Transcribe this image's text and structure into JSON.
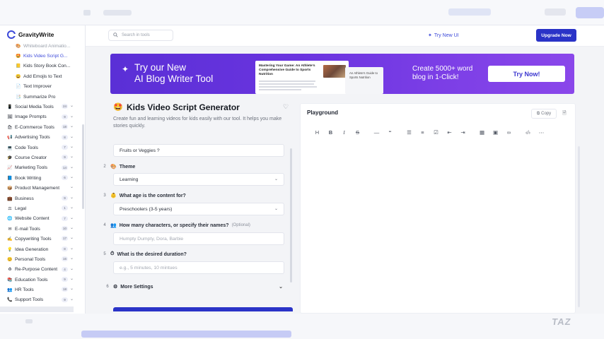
{
  "sidebar": {
    "logo": "GravityWrite",
    "items": [
      {
        "label": "Whiteboard Animatio...",
        "type": "sub",
        "icon": "🎨",
        "state": "faded"
      },
      {
        "label": "Kids Video Script G...",
        "type": "sub",
        "icon": "🤩",
        "state": "active"
      },
      {
        "label": "Kids Story Book Con...",
        "type": "sub",
        "icon": "📒"
      },
      {
        "label": "Add Emojis to Text",
        "type": "sub",
        "icon": "😀"
      },
      {
        "label": "Text Improver",
        "type": "sub",
        "icon": "📄"
      },
      {
        "label": "Summarize Pro",
        "type": "sub",
        "icon": "📑"
      },
      {
        "label": "Social Media Tools",
        "type": "cat",
        "icon": "📱",
        "count": "24"
      },
      {
        "label": "Image Prompts",
        "type": "cat",
        "icon": "🖼",
        "count": "9"
      },
      {
        "label": "E-Commerce Tools",
        "type": "cat",
        "icon": "🛍",
        "count": "18"
      },
      {
        "label": "Advertising Tools",
        "type": "cat",
        "icon": "📢",
        "count": "8"
      },
      {
        "label": "Code Tools",
        "type": "cat",
        "icon": "💻",
        "count": "7"
      },
      {
        "label": "Course Creator",
        "type": "cat",
        "icon": "🎓",
        "count": "9"
      },
      {
        "label": "Marketing Tools",
        "type": "cat",
        "icon": "📈",
        "count": "14"
      },
      {
        "label": "Book Writing",
        "type": "cat",
        "icon": "📘",
        "count": "6"
      },
      {
        "label": "Product Management",
        "type": "cat",
        "icon": "📦",
        "count": ""
      },
      {
        "label": "Business",
        "type": "cat",
        "icon": "💼",
        "count": "9"
      },
      {
        "label": "Legal",
        "type": "cat",
        "icon": "⚖",
        "count": "1"
      },
      {
        "label": "Website Content",
        "type": "cat",
        "icon": "🌐",
        "count": "7"
      },
      {
        "label": "E-mail Tools",
        "type": "cat",
        "icon": "✉",
        "count": "10"
      },
      {
        "label": "Copywriting Tools",
        "type": "cat",
        "icon": "✍",
        "count": "17"
      },
      {
        "label": "Idea Generation",
        "type": "cat",
        "icon": "💡",
        "count": "8"
      },
      {
        "label": "Personal Tools",
        "type": "cat",
        "icon": "😊",
        "count": "16"
      },
      {
        "label": "Re-Purpose Content",
        "type": "cat",
        "icon": "♻",
        "count": "4"
      },
      {
        "label": "Education Tools",
        "type": "cat",
        "icon": "📚",
        "count": "9"
      },
      {
        "label": "HR Tools",
        "type": "cat",
        "icon": "👥",
        "count": "18"
      },
      {
        "label": "Support Tools",
        "type": "cat",
        "icon": "📞",
        "count": "9"
      }
    ]
  },
  "header": {
    "search_placeholder": "Search in tools",
    "try_new_ui": "Try New UI",
    "upgrade": "Upgrade Now"
  },
  "banner": {
    "line1": "Try our New",
    "line2": "AI Blog Writer Tool",
    "doc_title": "Mastering Your Game: An Athlete's Comprehensive Guide to Sports Nutrition",
    "doc2_title": "An Athlete's Guide to Sports Nutrition",
    "cta_line1": "Create 5000+ word",
    "cta_line2": "blog in 1-Click!",
    "button": "Try Now!"
  },
  "form": {
    "title": "Kids Video Script Generator",
    "description": "Create fun and learning videos for kids easily with our tool. It helps you make stories quickly.",
    "topic_value": "Fruits or Veggies ?",
    "fields": [
      {
        "num": "2",
        "icon": "🎨",
        "label": "Theme",
        "value": "Learning",
        "kind": "select"
      },
      {
        "num": "3",
        "icon": "👶",
        "label": "What age is the content for?",
        "value": "Preschoolers (3-5 years)",
        "kind": "select"
      },
      {
        "num": "4",
        "icon": "👥",
        "label": "How many characters, or specify their names?",
        "optional": "(Optional)",
        "placeholder": "Humpty Dumpty, Dora, Barbie",
        "kind": "text"
      },
      {
        "num": "5",
        "icon": "⏱",
        "label": "What is the desired duration?",
        "placeholder": "e.g., 5 minutes, 10 mintues",
        "kind": "text"
      }
    ],
    "more_num": "6",
    "more_label": "More Settings"
  },
  "playground": {
    "title": "Playground",
    "copy": "Copy"
  },
  "colors": {
    "accent": "#2a33c7",
    "banner_start": "#5a2fd6",
    "banner_end": "#8a47ea"
  }
}
